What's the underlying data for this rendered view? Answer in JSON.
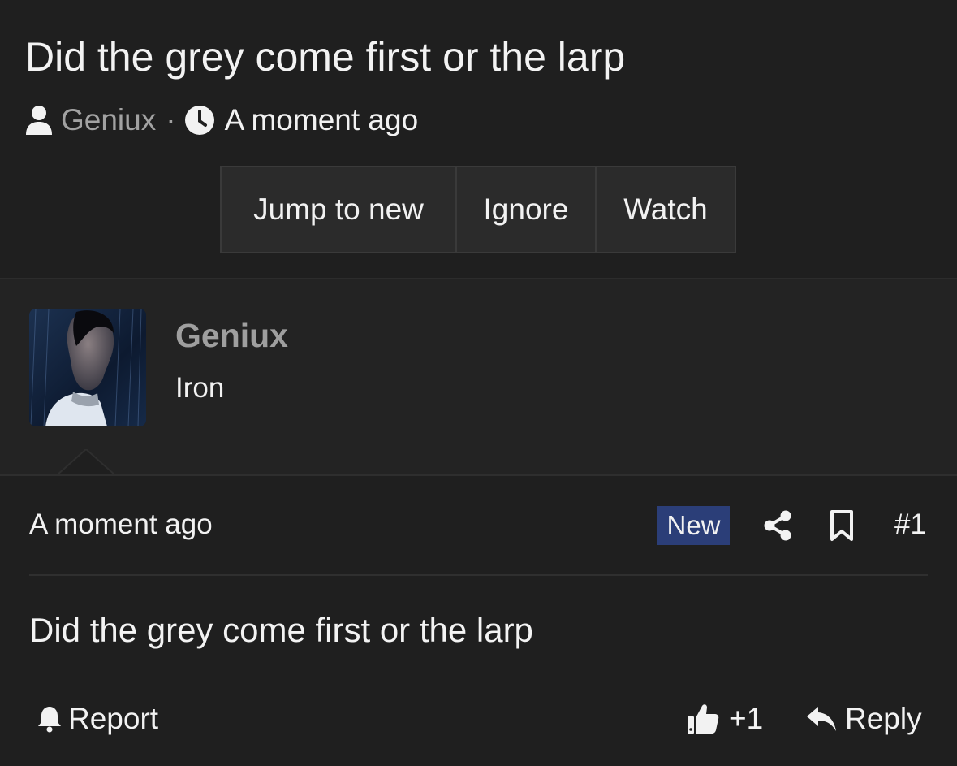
{
  "thread": {
    "title": "Did the grey come first or the larp",
    "author": "Geniux",
    "separator": "·",
    "time": "A moment ago",
    "icons": {
      "author": "user-icon",
      "time": "clock-icon"
    }
  },
  "actions": {
    "jump_to_new": "Jump to new",
    "ignore": "Ignore",
    "watch": "Watch"
  },
  "post": {
    "user": {
      "name": "Geniux",
      "title": "Iron",
      "avatar": "avatar-photo"
    },
    "time": "A moment ago",
    "badge": "New",
    "number": "#1",
    "body": "Did the grey come first or the larp",
    "icons": {
      "share": "share-icon",
      "bookmark": "bookmark-icon"
    },
    "footer": {
      "report": "Report",
      "like": "+1",
      "reply": "Reply",
      "icons": {
        "report": "bell-icon",
        "like": "thumbs-up-icon",
        "reply": "reply-arrow-icon"
      }
    }
  },
  "colors": {
    "background": "#1f1f1f",
    "post_background": "#232323",
    "muted_text": "#a2a2a2",
    "text": "#f2f2f2",
    "badge_new": "#2b3e78",
    "button_bg": "#2b2b2b"
  }
}
